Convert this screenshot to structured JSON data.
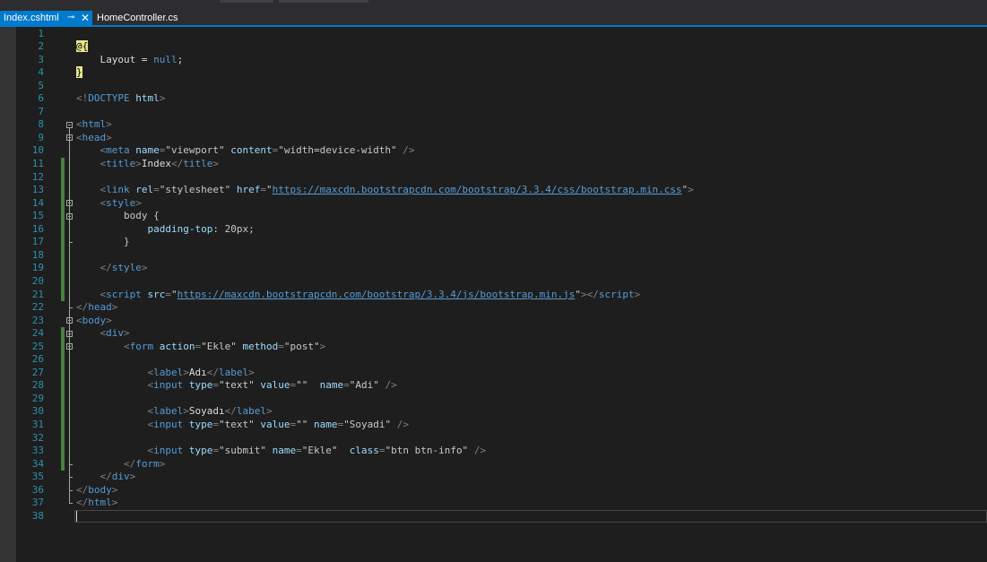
{
  "tabs": {
    "active": {
      "label": "Index.cshtml",
      "pin_icon": "pin-icon",
      "close_icon": "close-icon"
    },
    "inactive": {
      "label": "HomeController.cs"
    }
  },
  "colors": {
    "accent": "#007acc",
    "editor_bg": "#1e1e1e",
    "line_number": "#2b91af",
    "tag": "#569cd6",
    "attribute": "#9cdcfe",
    "change_bar": "#57a64a"
  },
  "editor": {
    "caret_line": 38,
    "lines": [
      [],
      [
        {
          "t": "@{",
          "c": "rz"
        }
      ],
      [
        {
          "t": "    Layout = "
        },
        {
          "t": "null",
          "c": "kw"
        },
        {
          "t": ";"
        }
      ],
      [
        {
          "t": "}",
          "c": "rz"
        }
      ],
      [],
      [
        {
          "t": "<!",
          "c": "punct"
        },
        {
          "t": "DOCTYPE",
          "c": "tag"
        },
        {
          "t": " "
        },
        {
          "t": "html",
          "c": "attr"
        },
        {
          "t": ">",
          "c": "punct"
        }
      ],
      [],
      [
        {
          "t": "<",
          "c": "punct"
        },
        {
          "t": "html",
          "c": "tag"
        },
        {
          "t": ">",
          "c": "punct"
        }
      ],
      [
        {
          "t": "<",
          "c": "punct"
        },
        {
          "t": "head",
          "c": "tag"
        },
        {
          "t": ">",
          "c": "punct"
        }
      ],
      [
        {
          "t": "    "
        },
        {
          "t": "<",
          "c": "punct"
        },
        {
          "t": "meta",
          "c": "tag"
        },
        {
          "t": " "
        },
        {
          "t": "name",
          "c": "attr"
        },
        {
          "t": "=",
          "c": "punct"
        },
        {
          "t": "\"viewport\"",
          "c": "str"
        },
        {
          "t": " "
        },
        {
          "t": "content",
          "c": "attr"
        },
        {
          "t": "=",
          "c": "punct"
        },
        {
          "t": "\"width=device-width\"",
          "c": "str"
        },
        {
          "t": " "
        },
        {
          "t": "/>",
          "c": "punct"
        }
      ],
      [
        {
          "t": "    "
        },
        {
          "t": "<",
          "c": "punct"
        },
        {
          "t": "title",
          "c": "tag"
        },
        {
          "t": ">",
          "c": "punct"
        },
        {
          "t": "Index"
        },
        {
          "t": "</",
          "c": "punct"
        },
        {
          "t": "title",
          "c": "tag"
        },
        {
          "t": ">",
          "c": "punct"
        }
      ],
      [],
      [
        {
          "t": "    "
        },
        {
          "t": "<",
          "c": "punct"
        },
        {
          "t": "link",
          "c": "tag"
        },
        {
          "t": " "
        },
        {
          "t": "rel",
          "c": "attr"
        },
        {
          "t": "=",
          "c": "punct"
        },
        {
          "t": "\"stylesheet\"",
          "c": "str"
        },
        {
          "t": " "
        },
        {
          "t": "href",
          "c": "attr"
        },
        {
          "t": "=",
          "c": "punct"
        },
        {
          "t": "\"",
          "c": "str"
        },
        {
          "t": "https://maxcdn.bootstrapcdn.com/bootstrap/3.3.4/css/bootstrap.min.css",
          "c": "url"
        },
        {
          "t": "\"",
          "c": "str"
        },
        {
          "t": ">",
          "c": "punct"
        }
      ],
      [
        {
          "t": "    "
        },
        {
          "t": "<",
          "c": "punct"
        },
        {
          "t": "style",
          "c": "tag"
        },
        {
          "t": ">",
          "c": "punct"
        }
      ],
      [
        {
          "t": "        body {",
          "c": "str"
        }
      ],
      [
        {
          "t": "            "
        },
        {
          "t": "padding-top",
          "c": "attr"
        },
        {
          "t": ": 20px;",
          "c": "str"
        }
      ],
      [
        {
          "t": "        }",
          "c": "str"
        }
      ],
      [],
      [
        {
          "t": "    "
        },
        {
          "t": "</",
          "c": "punct"
        },
        {
          "t": "style",
          "c": "tag"
        },
        {
          "t": ">",
          "c": "punct"
        }
      ],
      [],
      [
        {
          "t": "    "
        },
        {
          "t": "<",
          "c": "punct"
        },
        {
          "t": "script",
          "c": "tag"
        },
        {
          "t": " "
        },
        {
          "t": "src",
          "c": "attr"
        },
        {
          "t": "=",
          "c": "punct"
        },
        {
          "t": "\"",
          "c": "str"
        },
        {
          "t": "https://maxcdn.bootstrapcdn.com/bootstrap/3.3.4/js/bootstrap.min.js",
          "c": "url"
        },
        {
          "t": "\"",
          "c": "str"
        },
        {
          "t": "></",
          "c": "punct"
        },
        {
          "t": "script",
          "c": "tag"
        },
        {
          "t": ">",
          "c": "punct"
        }
      ],
      [
        {
          "t": "</",
          "c": "punct"
        },
        {
          "t": "head",
          "c": "tag"
        },
        {
          "t": ">",
          "c": "punct"
        }
      ],
      [
        {
          "t": "<",
          "c": "punct"
        },
        {
          "t": "body",
          "c": "tag"
        },
        {
          "t": ">",
          "c": "punct"
        }
      ],
      [
        {
          "t": "    "
        },
        {
          "t": "<",
          "c": "punct"
        },
        {
          "t": "div",
          "c": "tag"
        },
        {
          "t": ">",
          "c": "punct"
        }
      ],
      [
        {
          "t": "        "
        },
        {
          "t": "<",
          "c": "punct"
        },
        {
          "t": "form",
          "c": "tag"
        },
        {
          "t": " "
        },
        {
          "t": "action",
          "c": "attr"
        },
        {
          "t": "=",
          "c": "punct"
        },
        {
          "t": "\"Ekle\"",
          "c": "str"
        },
        {
          "t": " "
        },
        {
          "t": "method",
          "c": "attr"
        },
        {
          "t": "=",
          "c": "punct"
        },
        {
          "t": "\"post\"",
          "c": "str"
        },
        {
          "t": ">",
          "c": "punct"
        }
      ],
      [],
      [
        {
          "t": "            "
        },
        {
          "t": "<",
          "c": "punct"
        },
        {
          "t": "label",
          "c": "tag"
        },
        {
          "t": ">",
          "c": "punct"
        },
        {
          "t": "Adı"
        },
        {
          "t": "</",
          "c": "punct"
        },
        {
          "t": "label",
          "c": "tag"
        },
        {
          "t": ">",
          "c": "punct"
        }
      ],
      [
        {
          "t": "            "
        },
        {
          "t": "<",
          "c": "punct"
        },
        {
          "t": "input",
          "c": "tag"
        },
        {
          "t": " "
        },
        {
          "t": "type",
          "c": "attr"
        },
        {
          "t": "=",
          "c": "punct"
        },
        {
          "t": "\"text\"",
          "c": "str"
        },
        {
          "t": " "
        },
        {
          "t": "value",
          "c": "attr"
        },
        {
          "t": "=",
          "c": "punct"
        },
        {
          "t": "\"\"",
          "c": "str"
        },
        {
          "t": "  "
        },
        {
          "t": "name",
          "c": "attr"
        },
        {
          "t": "=",
          "c": "punct"
        },
        {
          "t": "\"Adi\"",
          "c": "str"
        },
        {
          "t": " "
        },
        {
          "t": "/>",
          "c": "punct"
        }
      ],
      [],
      [
        {
          "t": "            "
        },
        {
          "t": "<",
          "c": "punct"
        },
        {
          "t": "label",
          "c": "tag"
        },
        {
          "t": ">",
          "c": "punct"
        },
        {
          "t": "Soyadı"
        },
        {
          "t": "</",
          "c": "punct"
        },
        {
          "t": "label",
          "c": "tag"
        },
        {
          "t": ">",
          "c": "punct"
        }
      ],
      [
        {
          "t": "            "
        },
        {
          "t": "<",
          "c": "punct"
        },
        {
          "t": "input",
          "c": "tag"
        },
        {
          "t": " "
        },
        {
          "t": "type",
          "c": "attr"
        },
        {
          "t": "=",
          "c": "punct"
        },
        {
          "t": "\"text\"",
          "c": "str"
        },
        {
          "t": " "
        },
        {
          "t": "value",
          "c": "attr"
        },
        {
          "t": "=",
          "c": "punct"
        },
        {
          "t": "\"\"",
          "c": "str"
        },
        {
          "t": " "
        },
        {
          "t": "name",
          "c": "attr"
        },
        {
          "t": "=",
          "c": "punct"
        },
        {
          "t": "\"Soyadi\"",
          "c": "str"
        },
        {
          "t": " "
        },
        {
          "t": "/>",
          "c": "punct"
        }
      ],
      [],
      [
        {
          "t": "            "
        },
        {
          "t": "<",
          "c": "punct"
        },
        {
          "t": "input",
          "c": "tag"
        },
        {
          "t": " "
        },
        {
          "t": "type",
          "c": "attr"
        },
        {
          "t": "=",
          "c": "punct"
        },
        {
          "t": "\"submit\"",
          "c": "str"
        },
        {
          "t": " "
        },
        {
          "t": "name",
          "c": "attr"
        },
        {
          "t": "=",
          "c": "punct"
        },
        {
          "t": "\"Ekle\"",
          "c": "str"
        },
        {
          "t": "  "
        },
        {
          "t": "class",
          "c": "attr"
        },
        {
          "t": "=",
          "c": "punct"
        },
        {
          "t": "\"btn btn-info\"",
          "c": "str"
        },
        {
          "t": " "
        },
        {
          "t": "/>",
          "c": "punct"
        }
      ],
      [
        {
          "t": "        "
        },
        {
          "t": "</",
          "c": "punct"
        },
        {
          "t": "form",
          "c": "tag"
        },
        {
          "t": ">",
          "c": "punct"
        }
      ],
      [
        {
          "t": "    "
        },
        {
          "t": "</",
          "c": "punct"
        },
        {
          "t": "div",
          "c": "tag"
        },
        {
          "t": ">",
          "c": "punct"
        }
      ],
      [
        {
          "t": "</",
          "c": "punct"
        },
        {
          "t": "body",
          "c": "tag"
        },
        {
          "t": ">",
          "c": "punct"
        }
      ],
      [
        {
          "t": "</",
          "c": "punct"
        },
        {
          "t": "html",
          "c": "tag"
        },
        {
          "t": ">",
          "c": "punct"
        }
      ],
      []
    ]
  }
}
